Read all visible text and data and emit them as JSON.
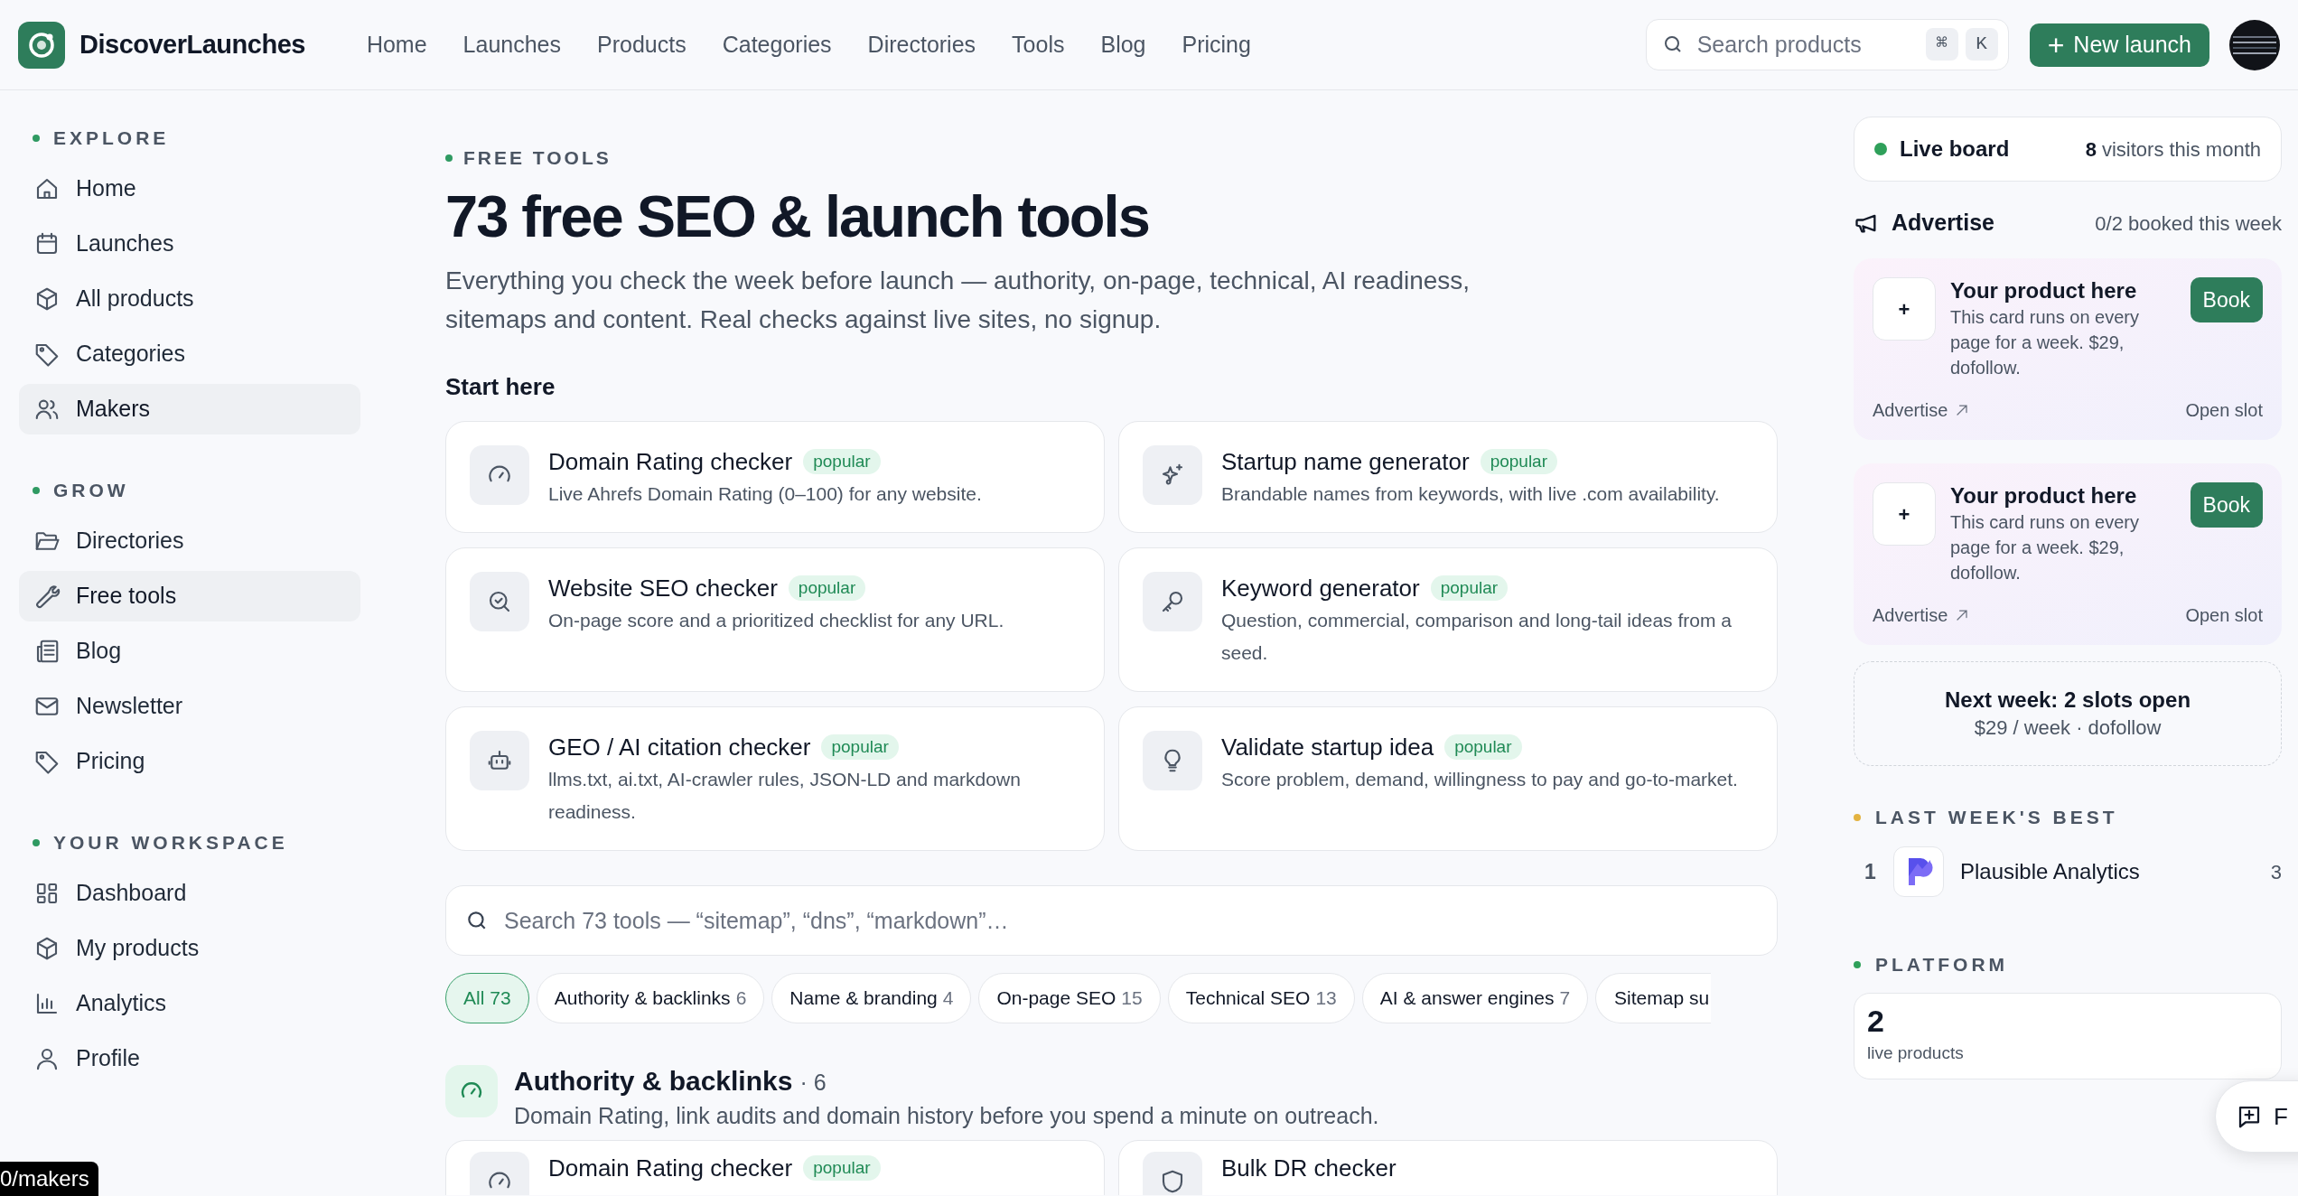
{
  "header": {
    "brand": "DiscoverLaunches",
    "nav": [
      "Home",
      "Launches",
      "Products",
      "Categories",
      "Directories",
      "Tools",
      "Blog",
      "Pricing"
    ],
    "search": {
      "placeholder": "Search products",
      "keys": [
        "⌘",
        "K"
      ]
    },
    "new_button": {
      "icon": "+",
      "label": "New launch"
    }
  },
  "sidebar": {
    "sections": [
      {
        "title": "EXPLORE",
        "items": [
          {
            "label": "Home",
            "selected": false
          },
          {
            "label": "Launches",
            "selected": false
          },
          {
            "label": "All products",
            "selected": false
          },
          {
            "label": "Categories",
            "selected": false
          },
          {
            "label": "Makers",
            "selected": true
          }
        ]
      },
      {
        "title": "GROW",
        "items": [
          {
            "label": "Directories",
            "selected": false
          },
          {
            "label": "Free tools",
            "selected": true
          },
          {
            "label": "Blog",
            "selected": false
          },
          {
            "label": "Newsletter",
            "selected": false
          },
          {
            "label": "Pricing",
            "selected": false
          }
        ]
      },
      {
        "title": "YOUR WORKSPACE",
        "items": [
          {
            "label": "Dashboard",
            "selected": false
          },
          {
            "label": "My products",
            "selected": false
          },
          {
            "label": "Analytics",
            "selected": false
          },
          {
            "label": "Profile",
            "selected": false
          }
        ]
      }
    ]
  },
  "main": {
    "eyebrow": "FREE TOOLS",
    "title": "73 free SEO & launch tools",
    "intro": "Everything you check the week before launch — authority, on-page, technical, AI readiness, sitemaps and content. Real checks against live sites, no signup.",
    "start_here": "Start here",
    "featured": [
      {
        "title": "Domain Rating checker",
        "badge": "popular",
        "description": "Live Ahrefs Domain Rating (0–100) for any website."
      },
      {
        "title": "Startup name generator",
        "badge": "popular",
        "description": "Brandable names from keywords, with live .com availability."
      },
      {
        "title": "Website SEO checker",
        "badge": "popular",
        "description": "On-page score and a prioritized checklist for any URL."
      },
      {
        "title": "Keyword generator",
        "badge": "popular",
        "description": "Question, commercial, comparison and long-tail ideas from a seed."
      },
      {
        "title": "GEO / AI citation checker",
        "badge": "popular",
        "description": "llms.txt, ai.txt, AI-crawler rules, JSON-LD and markdown readiness."
      },
      {
        "title": "Validate startup idea",
        "badge": "popular",
        "description": "Score problem, demand, willingness to pay and go-to-market."
      }
    ],
    "tool_search": {
      "placeholder": "Search 73 tools — “sitemap”, “dns”, “markdown”…"
    },
    "filters": [
      {
        "label": "All",
        "count": "73",
        "selected": true
      },
      {
        "label": "Authority & backlinks",
        "count": "6",
        "selected": false
      },
      {
        "label": "Name & branding",
        "count": "4",
        "selected": false
      },
      {
        "label": "On-page SEO",
        "count": "15",
        "selected": false
      },
      {
        "label": "Technical SEO",
        "count": "13",
        "selected": false
      },
      {
        "label": "AI & answer engines",
        "count": "7",
        "selected": false
      },
      {
        "label": "Sitemap su",
        "selected": false
      }
    ],
    "section": {
      "title": "Authority & backlinks",
      "count": "· 6",
      "description": "Domain Rating, link audits and domain history before you spend a minute on outreach.",
      "tools": [
        {
          "title": "Domain Rating checker",
          "badge": "popular"
        },
        {
          "title": "Bulk DR checker"
        }
      ]
    }
  },
  "aside": {
    "live_board": {
      "label": "Live board",
      "count": "8",
      "suffix": "visitors this month"
    },
    "advertise": {
      "title": "Advertise",
      "booked": "0/2 booked this week",
      "slots": [
        {
          "plus": "+",
          "title": "Your product here",
          "description": "This card runs on every page for a week. $29, dofollow.",
          "button": "Book",
          "link": "Advertise",
          "status": "Open slot"
        },
        {
          "plus": "+",
          "title": "Your product here",
          "description": "This card runs on every page for a week. $29, dofollow.",
          "button": "Book",
          "link": "Advertise",
          "status": "Open slot"
        }
      ]
    },
    "next_week": {
      "title": "Next week: 2 slots open",
      "subtitle": "$29 / week · dofollow"
    },
    "best": {
      "title": "LAST WEEK'S BEST",
      "items": [
        {
          "rank": "1",
          "name": "Plausible Analytics",
          "votes": "3"
        }
      ]
    },
    "platform": {
      "title": "PLATFORM",
      "stats": [
        {
          "value": "2",
          "label": "live products"
        }
      ]
    }
  },
  "feedback": {
    "label": "F"
  },
  "tooltip": "0/makers"
}
